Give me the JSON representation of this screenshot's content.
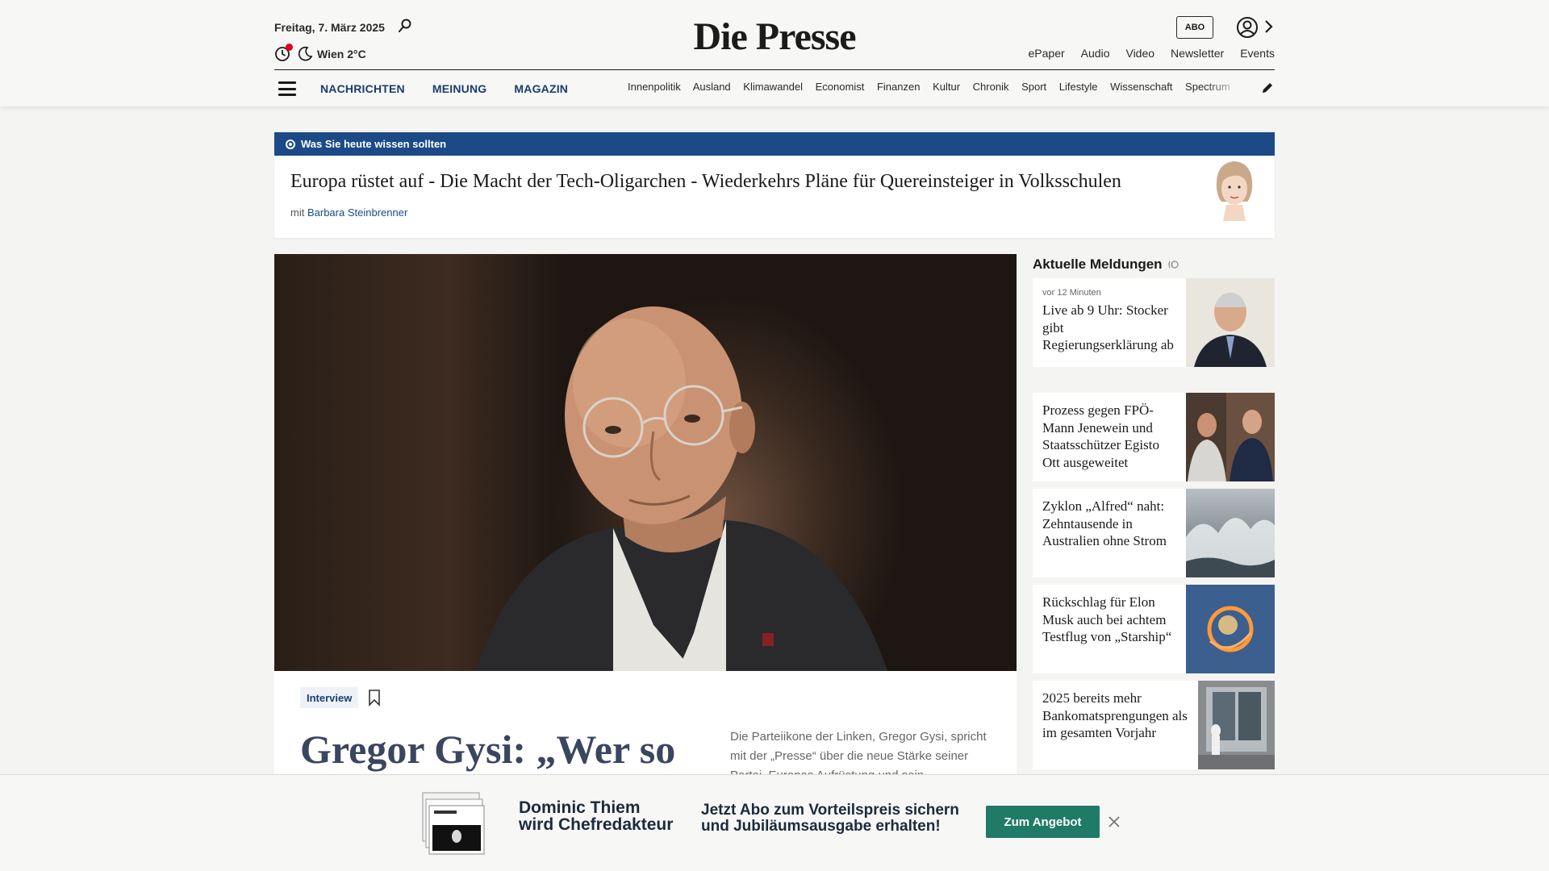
{
  "header": {
    "date": "Freitag, 7. März 2025",
    "weather": "Wien 2°C",
    "logo": "Die Presse",
    "abo_label": "ABO",
    "top_links": [
      "ePaper",
      "Audio",
      "Video",
      "Newsletter",
      "Events"
    ],
    "main_nav": [
      "NACHRICHTEN",
      "MEINUNG",
      "MAGAZIN"
    ],
    "sub_nav": [
      "Innenpolitik",
      "Ausland",
      "Klimawandel",
      "Economist",
      "Finanzen",
      "Kultur",
      "Chronik",
      "Sport",
      "Lifestyle",
      "Wissenschaft",
      "Spectrum"
    ]
  },
  "briefing": {
    "label": "Was Sie heute wissen sollten",
    "headline": "Europa rüstet auf - Die Macht der Tech-Oligarchen - Wiederkehrs Pläne für Quereinsteiger in Volksschulen",
    "author_prefix": "mit",
    "author": "Barbara Steinbrenner"
  },
  "article": {
    "tag": "Interview",
    "title": "Gregor Gysi: „Wer so",
    "teaser": "Die Parteiikone der Linken, Gregor Gysi, spricht mit der „Presse“ über die neue Stärke seiner Partei, Europas Aufrüstung und sein"
  },
  "sidebar": {
    "title": "Aktuelle Meldungen",
    "items": [
      {
        "meta": "vor 12 Minuten",
        "text": "Live ab 9 Uhr: Stocker gibt Regierungserklärung ab"
      },
      {
        "meta": "",
        "text": "Prozess gegen FPÖ-Mann Jenewein und Staatsschützer Egisto Ott ausgeweitet"
      },
      {
        "meta": "",
        "text": "Zyklon „Alfred“ naht: Zehntausende in Australien ohne Strom"
      },
      {
        "meta": "",
        "text": "Rückschlag für Elon Musk auch bei achtem Testflug von „Starship“"
      },
      {
        "meta": "",
        "text": "2025 bereits mehr Bankomatsprengungen als im gesamten Vorjahr"
      }
    ]
  },
  "promo": {
    "name_line1": "Dominic Thiem",
    "name_line2": "wird Chefredakteur",
    "offer_line1": "Jetzt Abo zum Vorteilspreis sichern",
    "offer_line2": "und Jubiläumsausgabe erhalten!",
    "button": "Zum Angebot"
  },
  "colors": {
    "brand_blue": "#1b4a86",
    "nav_blue": "#1a3c6e",
    "cta_green": "#1f7a66",
    "alert_red": "#e2001a"
  }
}
